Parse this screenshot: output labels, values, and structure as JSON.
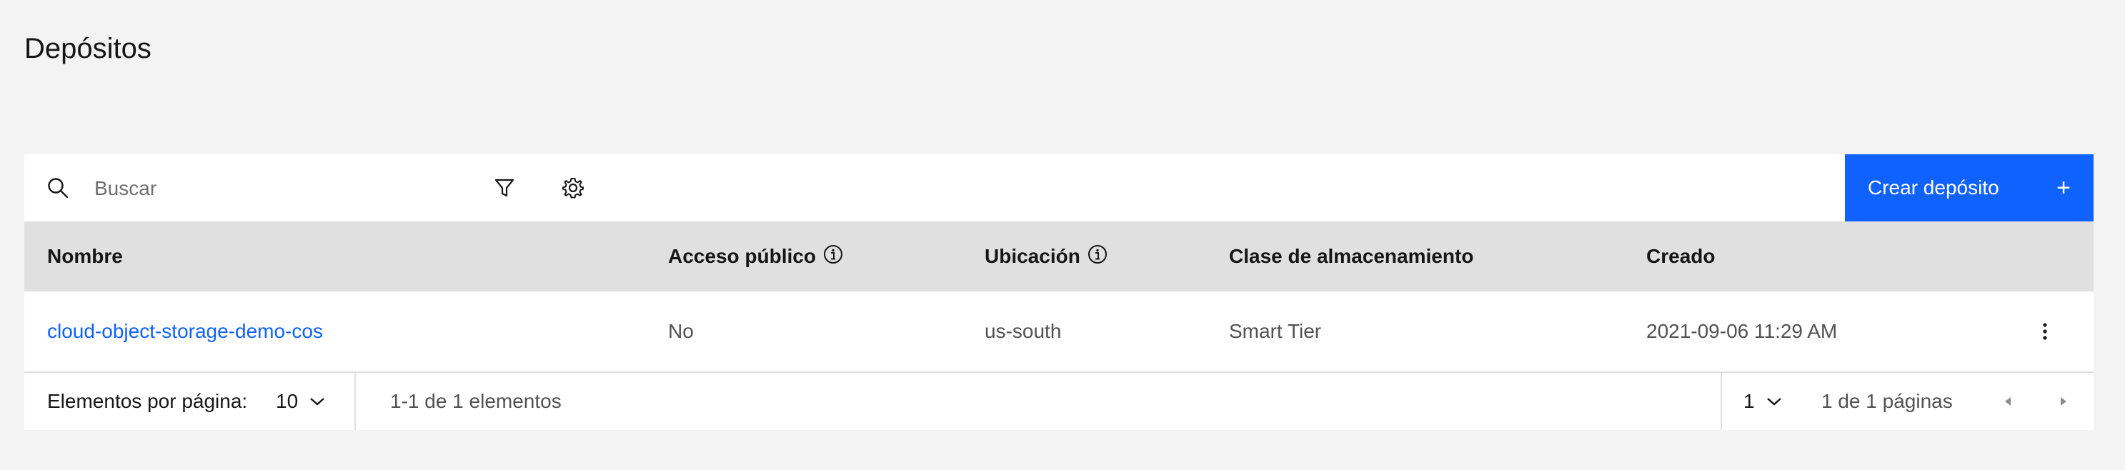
{
  "page": {
    "title": "Depósitos"
  },
  "toolbar": {
    "search_placeholder": "Buscar",
    "search_value": "",
    "create_label": "Crear depósito",
    "create_plus": "+"
  },
  "table": {
    "headers": {
      "name": "Nombre",
      "public_access": "Acceso público",
      "location": "Ubicación",
      "storage_class": "Clase de almacenamiento",
      "created": "Creado"
    },
    "rows": [
      {
        "name": "cloud-object-storage-demo-cos",
        "public_access": "No",
        "location": "us-south",
        "storage_class": "Smart Tier",
        "created": "2021-09-06 11:29 AM"
      }
    ]
  },
  "pagination": {
    "items_per_page_label": "Elementos por página:",
    "items_per_page_value": "10",
    "range_text": "1-1 de 1 elementos",
    "page_value": "1",
    "pages_text": "1 de 1 páginas"
  },
  "colors": {
    "accent": "#0f62fe",
    "background": "#f3f3f3",
    "header_bg": "#e0e0e0"
  },
  "icons": [
    "search-icon",
    "filter-icon",
    "gear-icon",
    "plus-icon",
    "info-icon",
    "overflow-menu-icon",
    "chevron-down-icon",
    "caret-left-icon",
    "caret-right-icon"
  ]
}
